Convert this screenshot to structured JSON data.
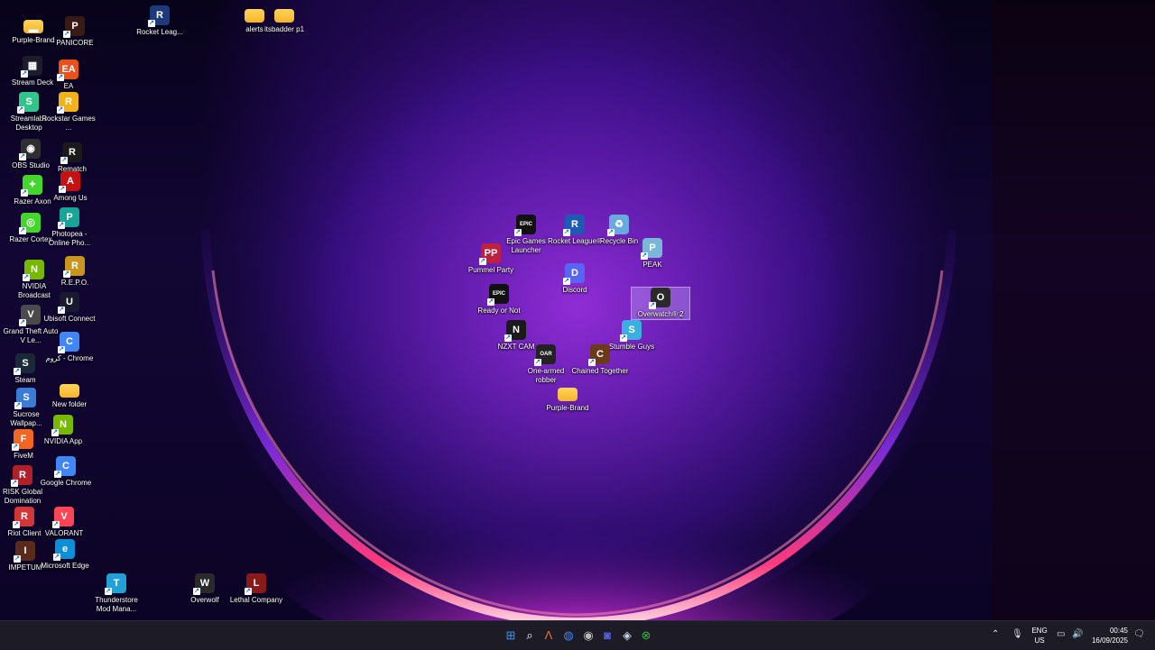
{
  "desktop": {
    "icons": [
      {
        "label": "Purple-Brand",
        "color": "#f5c542",
        "glyph": "▬",
        "folder": true
      },
      {
        "label": "PANICORE",
        "color": "#3a1a14",
        "glyph": "P"
      },
      {
        "label": "Rocket Leag...",
        "color": "#1e3a7a",
        "glyph": "R"
      },
      {
        "label": "alerts",
        "color": "#f5c542",
        "glyph": "",
        "folder": true
      },
      {
        "label": "itsbadder p1",
        "color": "#f5c542",
        "glyph": "",
        "folder": true
      },
      {
        "label": "Stream Deck",
        "color": "#1c1c2a",
        "glyph": "▦"
      },
      {
        "label": "EA",
        "color": "#e8501c",
        "glyph": "EA"
      },
      {
        "label": "Streamlabs Desktop",
        "color": "#31c48d",
        "glyph": "S"
      },
      {
        "label": "Rockstar Games ...",
        "color": "#f3b21a",
        "glyph": "R"
      },
      {
        "label": "OBS Studio",
        "color": "#302e31",
        "glyph": "◉"
      },
      {
        "label": "Rematch",
        "color": "#1a1a1a",
        "glyph": "R"
      },
      {
        "label": "Razer Axon",
        "color": "#44d62c",
        "glyph": "✦"
      },
      {
        "label": "Among Us",
        "color": "#c51111",
        "glyph": "A"
      },
      {
        "label": "Razer Cortex",
        "color": "#44d62c",
        "glyph": "◎"
      },
      {
        "label": "Photopea - Online Pho...",
        "color": "#18a497",
        "glyph": "P"
      },
      {
        "label": "NVIDIA Broadcast",
        "color": "#76b900",
        "glyph": "N"
      },
      {
        "label": "R.E.P.O.",
        "color": "#c8961e",
        "glyph": "R"
      },
      {
        "label": "Grand Theft Auto V Le...",
        "color": "#4a4a4a",
        "glyph": "V"
      },
      {
        "label": "Ubisoft Connect",
        "color": "#1a1a2e",
        "glyph": "U"
      },
      {
        "label": "Steam",
        "color": "#1b2838",
        "glyph": "S"
      },
      {
        "label": "كروم - Chrome",
        "color": "#4285f4",
        "glyph": "C"
      },
      {
        "label": "Sucrose Wallpap...",
        "color": "#3a7bd5",
        "glyph": "S"
      },
      {
        "label": "New folder",
        "color": "#f5c542",
        "glyph": "",
        "folder": true
      },
      {
        "label": "NVIDIA App",
        "color": "#76b900",
        "glyph": "N"
      },
      {
        "label": "FiveM",
        "color": "#f26522",
        "glyph": "F"
      },
      {
        "label": "RISK Global Domination",
        "color": "#b0202a",
        "glyph": "R"
      },
      {
        "label": "Google Chrome",
        "color": "#4285f4",
        "glyph": "C"
      },
      {
        "label": "Riot Client",
        "color": "#d13639",
        "glyph": "R"
      },
      {
        "label": "VALORANT",
        "color": "#fd4556",
        "glyph": "V"
      },
      {
        "label": "IMPETUM",
        "color": "#5a2a1a",
        "glyph": "I"
      },
      {
        "label": "Microsoft Edge",
        "color": "#0c8fd6",
        "glyph": "e"
      },
      {
        "label": "Thunderstore Mod Mana...",
        "color": "#23a0d6",
        "glyph": "T"
      },
      {
        "label": "Overwolf",
        "color": "#2a2a2a",
        "glyph": "W"
      },
      {
        "label": "Lethal Company",
        "color": "#8a1a1a",
        "glyph": "L"
      },
      {
        "label": "Epic Games Launcher",
        "color": "#111111",
        "glyph": "EPIC"
      },
      {
        "label": "Rocket League®",
        "color": "#1e5ab4",
        "glyph": "R"
      },
      {
        "label": "Recycle Bin",
        "color": "#6aa8e0",
        "glyph": "♻"
      },
      {
        "label": "PEAK",
        "color": "#7ab6d8",
        "glyph": "P"
      },
      {
        "label": "Pummel Party",
        "color": "#c02040",
        "glyph": "PP"
      },
      {
        "label": "Discord",
        "color": "#5865f2",
        "glyph": "D"
      },
      {
        "label": "Ready or Not",
        "color": "#111111",
        "glyph": "EPIC"
      },
      {
        "label": "Overwatch® 2",
        "color": "#2a2a2a",
        "glyph": "O",
        "selected": true
      },
      {
        "label": "NZXT CAM",
        "color": "#1a1a1a",
        "glyph": "N"
      },
      {
        "label": "Stumble Guys",
        "color": "#3ab0e0",
        "glyph": "S"
      },
      {
        "label": "One-armed robber",
        "color": "#222222",
        "glyph": "OAR"
      },
      {
        "label": "Chained Together",
        "color": "#6a3a1a",
        "glyph": "C"
      },
      {
        "label": "Purple-Brand",
        "color": "#f5c542",
        "glyph": "",
        "folder": true
      }
    ]
  },
  "taskbar": {
    "apps": [
      {
        "name": "start",
        "glyph": "⊞",
        "color": "#3a96f0"
      },
      {
        "name": "search",
        "glyph": "⌕",
        "color": "#ffffff"
      },
      {
        "name": "app-a",
        "glyph": "Λ",
        "color": "#f07030"
      },
      {
        "name": "chrome",
        "glyph": "◍",
        "color": "#4285f4"
      },
      {
        "name": "obs",
        "glyph": "◉",
        "color": "#bbbbbb"
      },
      {
        "name": "discord",
        "glyph": "◙",
        "color": "#5865f2"
      },
      {
        "name": "steam",
        "glyph": "◈",
        "color": "#c7d5e0"
      },
      {
        "name": "xbox",
        "glyph": "⊗",
        "color": "#2dbd3a"
      }
    ],
    "lang_top": "ENG",
    "lang_bottom": "US",
    "time": "00:45",
    "date": "16/09/2025"
  }
}
